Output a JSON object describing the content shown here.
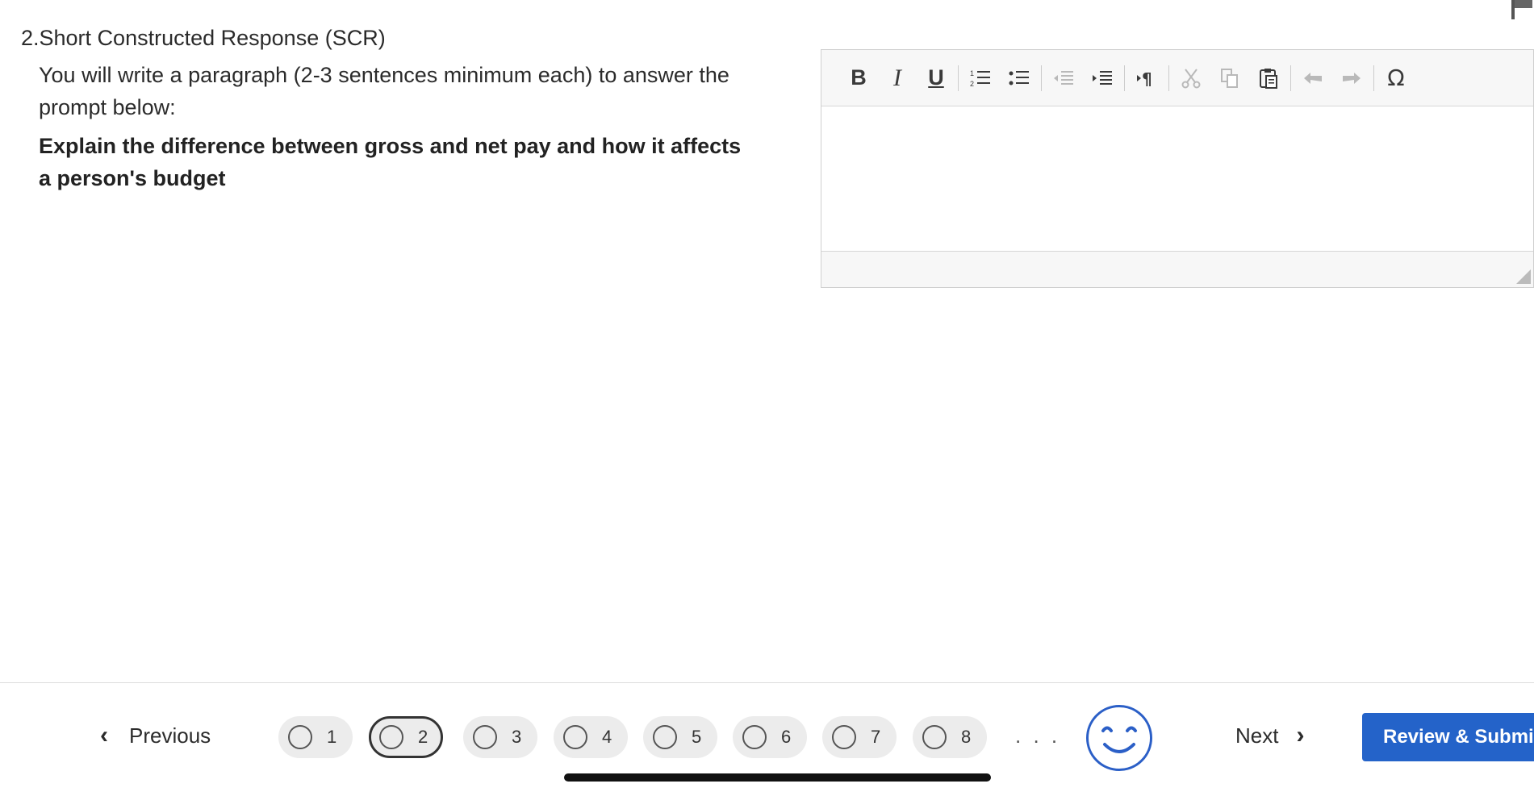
{
  "question": {
    "number": "2.",
    "type_label": "Short Constructed Response (SCR)",
    "title": "2.Short Constructed Response (SCR)",
    "instructions": "You will write a paragraph (2-3 sentences minimum each) to answer the prompt below:",
    "prompt": "Explain the difference between gross and net pay and how it affects a person's budget"
  },
  "editor": {
    "toolbar": [
      {
        "icon": "bold-icon",
        "glyph": "B"
      },
      {
        "icon": "italic-icon",
        "glyph": "I"
      },
      {
        "icon": "underline-icon",
        "glyph": "U"
      },
      {
        "icon": "numbered-list-icon"
      },
      {
        "icon": "bulleted-list-icon"
      },
      {
        "icon": "decrease-indent-icon",
        "disabled": true
      },
      {
        "icon": "increase-indent-icon"
      },
      {
        "icon": "text-direction-icon"
      },
      {
        "icon": "cut-icon",
        "disabled": true
      },
      {
        "icon": "copy-icon",
        "disabled": true
      },
      {
        "icon": "paste-icon"
      },
      {
        "icon": "undo-icon",
        "disabled": true
      },
      {
        "icon": "redo-icon",
        "disabled": true
      },
      {
        "icon": "special-character-icon",
        "glyph": "Ω"
      }
    ],
    "content": ""
  },
  "navigation": {
    "previous_label": "Previous",
    "next_label": "Next",
    "review_label": "Review & Submit",
    "ellipsis": ". . .",
    "current_question": 2,
    "questions": [
      "1",
      "2",
      "3",
      "4",
      "5",
      "6",
      "7",
      "8"
    ]
  },
  "colors": {
    "accent": "#2463c9",
    "smiley": "#2b5fc7"
  }
}
